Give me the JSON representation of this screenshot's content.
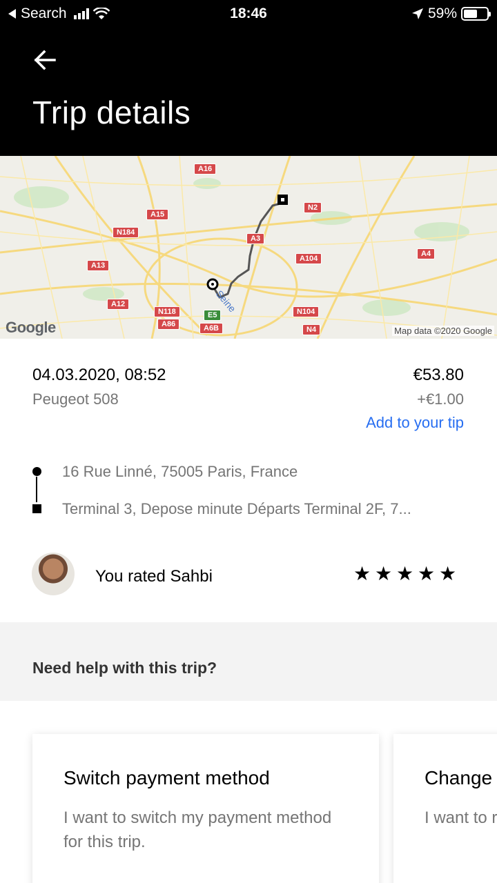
{
  "status_bar": {
    "back_app": "Search",
    "time": "18:46",
    "battery": "59%",
    "battery_level": 0.59,
    "back_arrow_icon": "triangle-left-icon",
    "signal_icon": "cellular-signal-icon",
    "wifi_icon": "wifi-icon",
    "location_icon": "location-arrow-icon",
    "battery_icon": "battery-icon"
  },
  "header": {
    "back_icon": "arrow-left-icon",
    "title": "Trip details"
  },
  "map": {
    "roads": [
      "A16",
      "N2",
      "A15",
      "N184",
      "A3",
      "A104",
      "A4",
      "A13",
      "A12",
      "N118",
      "A86",
      "E5",
      "A6B",
      "N104",
      "N4"
    ],
    "route_label": "Seine",
    "logo": "Google",
    "credit": "Map data ©2020 Google"
  },
  "trip": {
    "datetime": "04.03.2020, 08:52",
    "vehicle": "Peugeot 508",
    "price": "€53.80",
    "tip": "+€1.00",
    "add_tip": "Add to your tip",
    "pickup": "16 Rue Linné, 75005 Paris, France",
    "dropoff": "Terminal 3, Depose minute Départs Terminal 2F, 7..."
  },
  "rating": {
    "text": "You rated Sahbi",
    "stars": 5,
    "star_icon": "star-icon"
  },
  "help": {
    "title": "Need help with this trip?"
  },
  "cards": [
    {
      "title": "Switch payment method",
      "desc": "I want to switch my payment method for this trip."
    },
    {
      "title": "Change",
      "desc": "I want to rating."
    }
  ],
  "colors": {
    "header_bg": "#000000",
    "link": "#276ef1",
    "secondary_text": "#757575",
    "help_band": "#f3f3f3",
    "road_badge": "#d5484a"
  }
}
